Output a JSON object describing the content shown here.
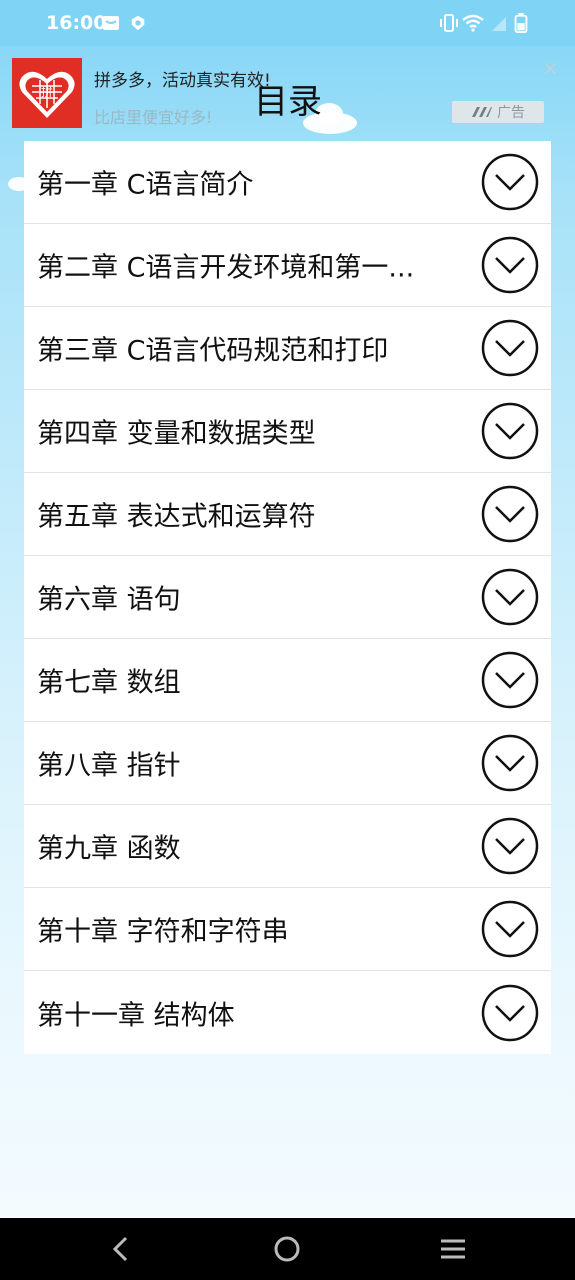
{
  "status_bar": {
    "time": "16:00",
    "icons": [
      "mail-icon",
      "shield-icon",
      "vibrate-icon",
      "wifi-icon",
      "signal-icon",
      "battery-icon"
    ]
  },
  "ad": {
    "title": "拼多多，活动真实有效!",
    "subtitle": "比店里便宜好多!",
    "badge": "广告",
    "logo_text": "拼",
    "close": "×"
  },
  "page": {
    "title": "目录"
  },
  "chapters": [
    {
      "label": "第一章 C语言简介"
    },
    {
      "label": "第二章 C语言开发环境和第一..."
    },
    {
      "label": "第三章 C语言代码规范和打印"
    },
    {
      "label": "第四章 变量和数据类型"
    },
    {
      "label": "第五章 表达式和运算符"
    },
    {
      "label": "第六章 语句"
    },
    {
      "label": "第七章 数组"
    },
    {
      "label": "第八章 指针"
    },
    {
      "label": "第九章 函数"
    },
    {
      "label": "第十章 字符和字符串"
    },
    {
      "label": "第十一章 结构体"
    }
  ],
  "nav": {
    "icons": [
      "back-icon",
      "home-icon",
      "menu-icon"
    ]
  },
  "colors": {
    "header": "#7fd3f5",
    "ad_logo": "#e02e24",
    "list_bg": "#ffffff",
    "nav_bg": "#000000"
  }
}
